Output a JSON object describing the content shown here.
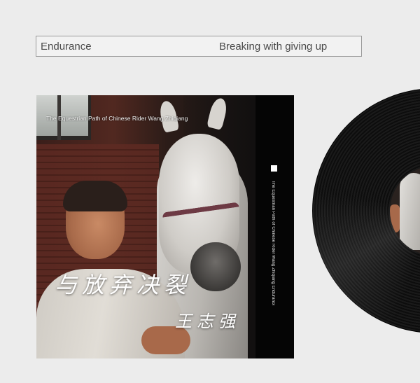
{
  "header": {
    "left_text": "Endurance",
    "right_text": "Breaking with giving up"
  },
  "cover": {
    "subtitle": "The Equestrian Path of Chinese Rider Wang Zhiqiang",
    "side_text": "The Equestrian Path of Chinese Rider Wang Zhiqiang  Endurance  Breaking with giving up",
    "title_cn": "与放弃决裂",
    "name_cn": "王志强"
  },
  "colors": {
    "background": "#ececec",
    "header_border": "#9a9a9a",
    "vinyl": "#111111",
    "strip": "#050505"
  },
  "icons": [
    "white-square-icon"
  ]
}
